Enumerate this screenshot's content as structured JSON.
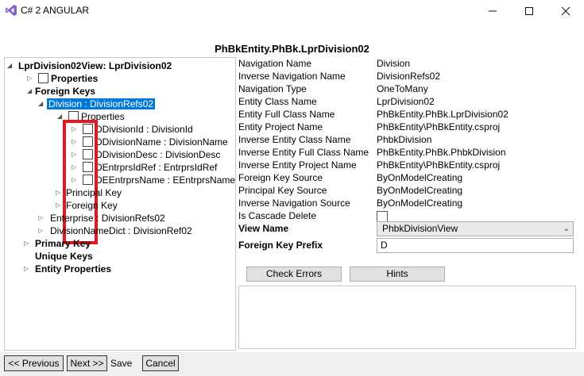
{
  "window": {
    "title": "C# 2 ANGULAR",
    "icons": {
      "app": "visual-studio-icon",
      "minimize": "minimize-icon",
      "maximize": "maximize-icon",
      "close": "close-icon"
    }
  },
  "heading": "PhBkEntity.PhBk.LprDivision02",
  "tree": {
    "root": "LprDivision02View: LprDivision02",
    "properties": "Properties",
    "foreign_keys": "Foreign Keys",
    "division": "Division : DivisionRefs02",
    "division_properties": "Properties",
    "fields": [
      "DDivisionId : DivisionId",
      "DDivisionName : DivisionName",
      "DDivisionDesc : DivisionDesc",
      "DEntrprsIdRef : EntrprsIdRef",
      "DEEntrprsName : EEntrprsName"
    ],
    "principal_key": "Principal Key",
    "foreign_key": "Foreign Key",
    "enterprise": "Enterprise : DivisionRefs02",
    "division_name_dict": "DivisionNameDict : DivisionRef02",
    "primary_key": "Primary Key",
    "unique_keys": "Unique Keys",
    "entity_properties": "Entity Properties"
  },
  "properties": [
    {
      "label": "Navigation Name",
      "value": "Division"
    },
    {
      "label": "Inverse Navigation Name",
      "value": "DivisionRefs02"
    },
    {
      "label": "Navigation Type",
      "value": "OneToMany"
    },
    {
      "label": "Entity Class Name",
      "value": "LprDivision02"
    },
    {
      "label": "Entity Full Class Name",
      "value": "PhBkEntity.PhBk.LprDivision02"
    },
    {
      "label": "Entity Project Name",
      "value": "PhBkEntity\\PhBkEntity.csproj"
    },
    {
      "label": "Inverse Entity Class Name",
      "value": "PhbkDivision"
    },
    {
      "label": "Inverse Entity Full Class Name",
      "value": "PhBkEntity.PhBk.PhbkDivision"
    },
    {
      "label": "Inverse Entity Project Name",
      "value": "PhBkEntity\\PhBkEntity.csproj"
    },
    {
      "label": "Foreign Key Source",
      "value": "ByOnModelCreating"
    },
    {
      "label": "Principal Key Source",
      "value": "ByOnModelCreating"
    },
    {
      "label": "Inverse Navigation Source",
      "value": "ByOnModelCreating"
    },
    {
      "label": "Is Cascade Delete",
      "value": ""
    }
  ],
  "view_name": {
    "label": "View Name",
    "value": "PhbkDivisionView"
  },
  "foreign_key_prefix": {
    "label": "Foreign Key Prefix",
    "value": "D"
  },
  "buttons": {
    "check_errors": "Check Errors",
    "hints": "Hints",
    "previous": "<< Previous",
    "next": "Next >>",
    "save": "Save",
    "cancel": "Cancel"
  },
  "colors": {
    "selection": "#0078d7",
    "highlight_frame": "#e8141f"
  }
}
